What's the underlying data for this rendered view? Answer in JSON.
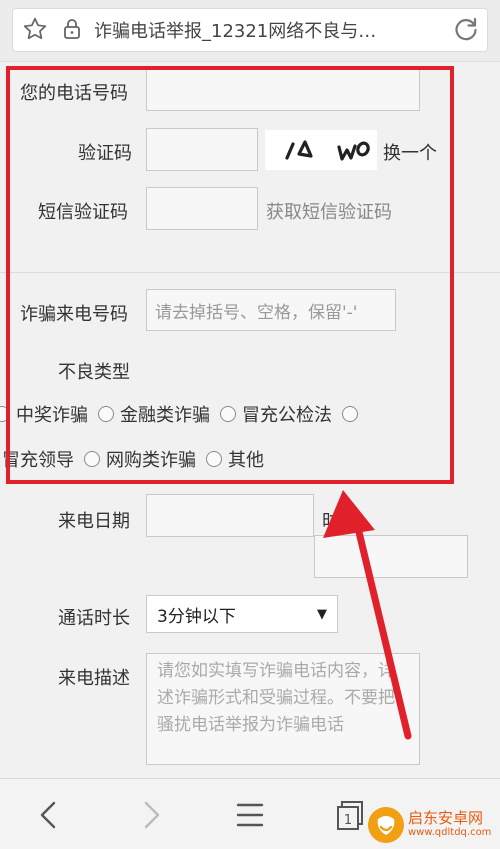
{
  "browser": {
    "url_title": "诈骗电话举报_12321网络不良与…"
  },
  "form": {
    "phone_label": "您的电话号码",
    "phone_value": "",
    "captcha_label": "验证码",
    "captcha_value": "",
    "captcha_image_text": "10 W0",
    "captcha_refresh": "换一个",
    "sms_label": "短信验证码",
    "sms_value": "",
    "sms_get": "获取短信验证码",
    "fraud_number_label": "诈骗来电号码",
    "fraud_number_placeholder": "请去掉括号、空格，保留'-'",
    "bad_type_label": "不良类型",
    "bad_types_row1": [
      "中奖诈骗",
      "金融类诈骗",
      "冒充公检法"
    ],
    "bad_types_row2": [
      "冒充领导",
      "网购类诈骗",
      "其他"
    ],
    "call_date_label": "来电日期",
    "call_time_label": "时间：",
    "duration_label": "通话时长",
    "duration_value": "3分钟以下",
    "description_label": "来电描述",
    "description_placeholder": "请您如实填写诈骗电话内容，详述诈骗形式和受骗过程。不要把骚扰电话举报为诈骗电话"
  },
  "watermark": {
    "name": "启东安卓网",
    "url": "www.qdltdq.com"
  },
  "colors": {
    "highlight": "#e0202a",
    "background": "#f1f1f1",
    "watermark": "#e85c0f"
  }
}
